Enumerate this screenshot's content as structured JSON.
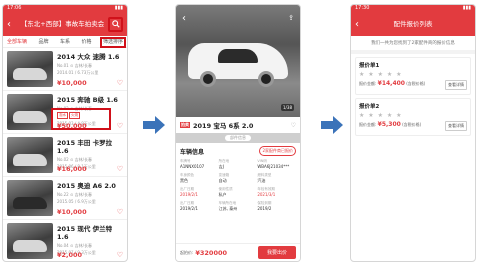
{
  "screen1": {
    "status_time": "17:06",
    "title": "【东北+西部】事故车拍卖会",
    "filters": [
      "全部车辆",
      "品牌",
      "车系",
      "价格",
      "筛选排序"
    ],
    "cars": [
      {
        "name": "2014 大众 速腾 1.6",
        "sub1": "No.01 ⊙ 吉林/长春",
        "sub2": "2014.01 / 6.73万公里",
        "tags": [],
        "price": "¥10,000"
      },
      {
        "name": "2015 奔驰 B级 1.6",
        "sub1": "No.02 ⊙ 吉林/长春",
        "sub2": "2015.03 / 4.8万公里",
        "tags": [
          "泡水",
          "火烧"
        ],
        "price": "¥50,000"
      },
      {
        "name": "2015 丰田 卡罗拉 1.6",
        "sub1": "No.02 ⊙ 吉林/长春",
        "sub2": "2015.06 / 8.1万公里",
        "tags": [],
        "price": "¥16,000"
      },
      {
        "name": "2015 奥迪 A6 2.0",
        "sub1": "No.22 ⊙ 吉林/长春",
        "sub2": "2015.05 / 6.9万公里",
        "tags": [],
        "price": "¥10,000"
      },
      {
        "name": "2015 现代 伊兰特 1.6",
        "sub1": "No.04 ⊙ 吉林/长春",
        "sub2": "2015.07 / 9.3万公里",
        "tags": [],
        "price": "¥2,000"
      }
    ]
  },
  "screen2": {
    "counter": "1/38",
    "badge": "拍卖",
    "title": "2019 宝马 6系 2.0",
    "graybar": "部件信息",
    "section": "车辆信息",
    "parts_btn": "2家配件商已报价",
    "fields": [
      {
        "k": "车牌号",
        "v": "A1NNX0107",
        "red": false
      },
      {
        "k": "所在地",
        "v": "吉J",
        "red": false
      },
      {
        "k": "VIN码",
        "v": "WBA6J21034***",
        "red": false
      },
      {
        "k": "车身颜色",
        "v": "黑色",
        "red": false
      },
      {
        "k": "变速箱",
        "v": "自动",
        "red": false
      },
      {
        "k": "燃料类型",
        "v": "汽油",
        "red": false
      },
      {
        "k": "出厂日期",
        "v": "2019/2/1",
        "red": true
      },
      {
        "k": "使用性质",
        "v": "私户",
        "red": false
      },
      {
        "k": "年检有效期",
        "v": "2021/3/1",
        "red": true
      },
      {
        "k": "出厂日期",
        "v": "2019/2/1",
        "red": false
      },
      {
        "k": "车辆所在地",
        "v": "江苏, 泰州",
        "red": false
      },
      {
        "k": "保险到期",
        "v": "2019/2",
        "red": false
      }
    ],
    "price_label": "起拍价:",
    "price": "¥320000",
    "buy_label": "我要出价"
  },
  "screen3": {
    "status_time": "17:30",
    "title": "配件报价列表",
    "notice": "我们一共为您找到了2家配件商的报价信息",
    "quotes": [
      {
        "name": "报价单1",
        "stars": "★ ★ ★ ★ ★",
        "label": "报价金额:",
        "price": "¥14,400",
        "tail": "(含税价格)",
        "button": "查看详情"
      },
      {
        "name": "报价单2",
        "stars": "★ ★ ★ ★ ★",
        "label": "报价金额:",
        "price": "¥5,300",
        "tail": "(含税价格)",
        "button": "查看详情"
      }
    ]
  }
}
